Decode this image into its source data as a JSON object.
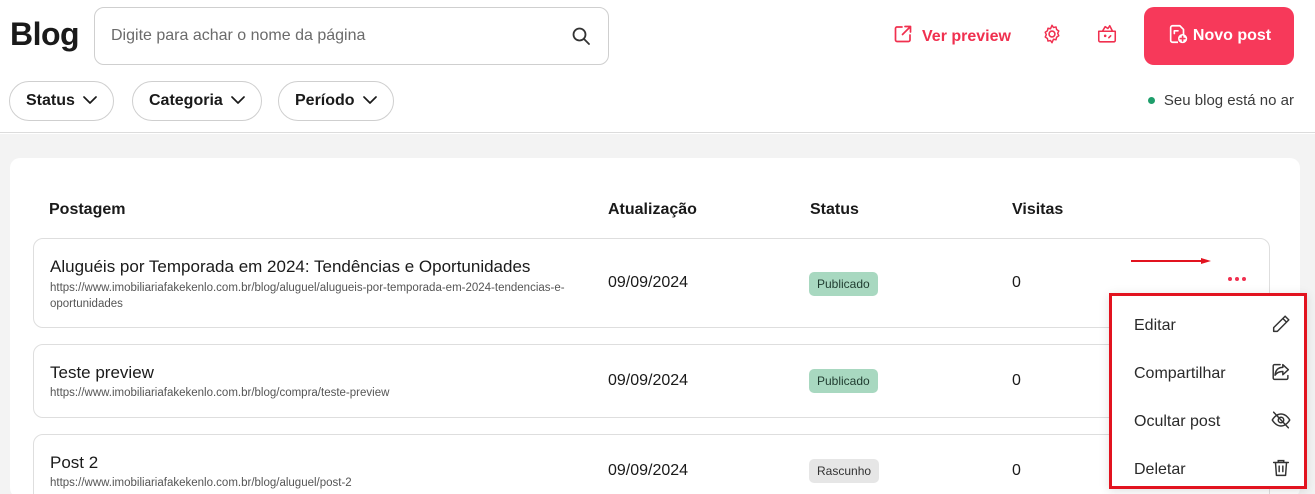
{
  "header": {
    "title": "Blog",
    "search_placeholder": "Digite para achar o nome da página",
    "preview_label": "Ver preview",
    "new_post_label": "Novo post",
    "blog_status": "Seu blog está no ar"
  },
  "filters": [
    "Status",
    "Categoria",
    "Período"
  ],
  "table": {
    "columns": [
      "Postagem",
      "Atualização",
      "Status",
      "Visitas"
    ],
    "rows": [
      {
        "title": "Aluguéis por Temporada em 2024: Tendências e Oportunidades",
        "url": "https://www.imobiliariafakekenlo.com.br/blog/aluguel/alugueis-por-temporada-em-2024-tendencias-e-oportunidades",
        "date": "09/09/2024",
        "status": "Publicado",
        "visits": "0"
      },
      {
        "title": "Teste preview",
        "url": "https://www.imobiliariafakekenlo.com.br/blog/compra/teste-preview",
        "date": "09/09/2024",
        "status": "Publicado",
        "visits": "0"
      },
      {
        "title": "Post 2",
        "url": "https://www.imobiliariafakekenlo.com.br/blog/aluguel/post-2",
        "date": "09/09/2024",
        "status": "Rascunho",
        "visits": "0"
      }
    ]
  },
  "context_menu": {
    "items": [
      {
        "label": "Editar",
        "icon": "pencil-icon"
      },
      {
        "label": "Compartilhar",
        "icon": "share-icon"
      },
      {
        "label": "Ocultar post",
        "icon": "eye-off-icon"
      },
      {
        "label": "Deletar",
        "icon": "trash-icon"
      }
    ]
  },
  "colors": {
    "accent": "#f7395a",
    "published_badge": "#a8d8c0",
    "draft_badge": "#e6e6e6",
    "online_dot": "#1e9e6b",
    "highlight": "#e2131f"
  }
}
